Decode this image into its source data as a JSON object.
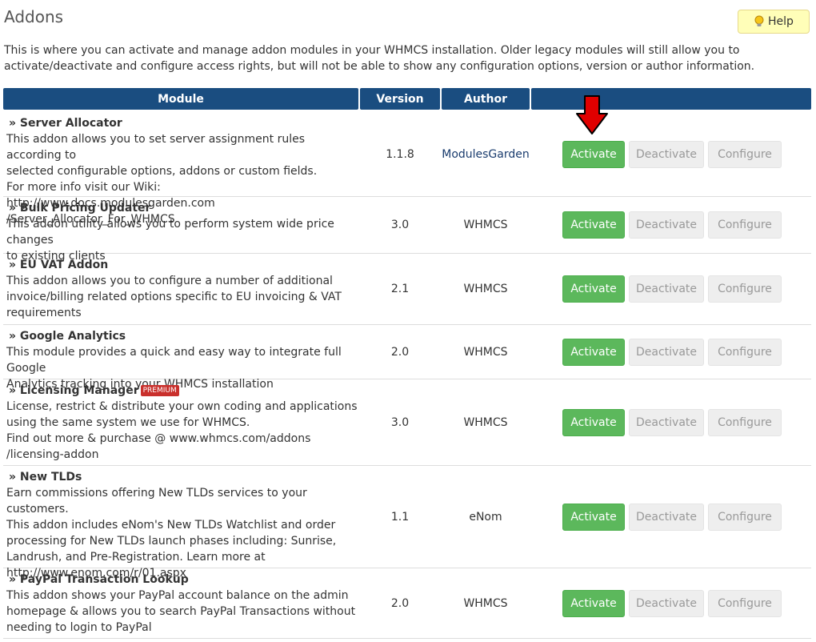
{
  "page": {
    "title": "Addons",
    "help_label": "Help",
    "intro": "This is where you can activate and manage addon modules in your WHMCS installation. Older legacy modules will still allow you to activate/deactivate and configure access rights, but will not be able to show any configuration options, version or author information."
  },
  "table": {
    "headers": {
      "module": "Module",
      "version": "Version",
      "author": "Author",
      "actions": ""
    },
    "rows": [
      {
        "name": "» Server Allocator",
        "description": [
          "This addon allows you to set server assignment rules according to",
          "selected configurable options, addons or custom fields.",
          "For more info visit our Wiki: http://www.docs.modulesgarden.com",
          "/Server_Allocator_For_WHMCS"
        ],
        "version": "1.1.8",
        "author": "ModulesGarden",
        "badge": ""
      },
      {
        "name": "» Bulk Pricing Updater",
        "description": [
          "This addon utility allows you to perform system wide price changes",
          "to existing clients"
        ],
        "version": "3.0",
        "author": "WHMCS",
        "badge": ""
      },
      {
        "name": "» EU VAT Addon",
        "description": [
          "This addon allows you to configure a number of additional",
          "invoice/billing related options specific to EU invoicing & VAT",
          "requirements"
        ],
        "version": "2.1",
        "author": "WHMCS",
        "badge": ""
      },
      {
        "name": "» Google Analytics",
        "description": [
          "This module provides a quick and easy way to integrate full Google",
          "Analytics tracking into your WHMCS installation"
        ],
        "version": "2.0",
        "author": "WHMCS",
        "badge": ""
      },
      {
        "name": "» Licensing Manager",
        "description": [
          "License, restrict & distribute your own coding and applications",
          "using the same system we use for WHMCS.",
          "Find out more & purchase @ www.whmcs.com/addons",
          "/licensing-addon"
        ],
        "version": "3.0",
        "author": "WHMCS",
        "badge": "PREMIUM"
      },
      {
        "name": "» New TLDs",
        "description": [
          "Earn commissions offering New TLDs services to your customers.",
          "This addon includes eNom's New TLDs Watchlist and order",
          "processing for New TLDs launch phases including: Sunrise,",
          "Landrush, and Pre-Registration. Learn more at",
          "http://www.enom.com/r/01.aspx"
        ],
        "version": "1.1",
        "author": "eNom",
        "badge": ""
      },
      {
        "name": "» PayPal Transaction Lookup",
        "description": [
          "This addon shows your PayPal account balance on the admin",
          "homepage & allows you to search PayPal Transactions without",
          "needing to login to PayPal"
        ],
        "version": "2.0",
        "author": "WHMCS",
        "badge": ""
      }
    ]
  },
  "buttons": {
    "activate": "Activate",
    "deactivate": "Deactivate",
    "configure": "Configure"
  },
  "icons": {
    "help": "lightbulb-icon",
    "pointer": "red-arrow-down-icon"
  },
  "colors": {
    "header": "#1a4d80",
    "activate": "#5cb85c",
    "arrow": "#e00000"
  }
}
